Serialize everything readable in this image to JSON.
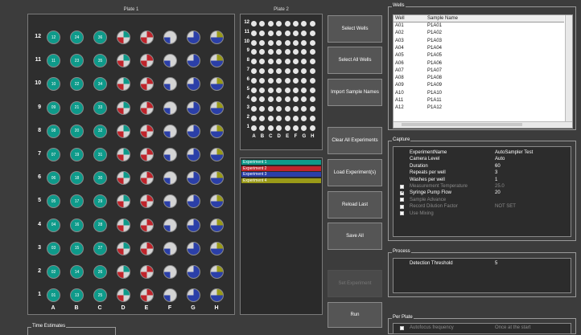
{
  "plate1": {
    "title": "Plate 1",
    "row_labels": [
      "12",
      "11",
      "10",
      "9",
      "8",
      "7",
      "6",
      "5",
      "4",
      "3",
      "2",
      "1"
    ],
    "col_labels": [
      "A",
      "B",
      "C",
      "D",
      "E",
      "F",
      "G",
      "H"
    ],
    "well_numbers": [
      [
        "12",
        "24",
        "36"
      ],
      [
        "11",
        "23",
        "35"
      ],
      [
        "10",
        "22",
        "34"
      ],
      [
        "09",
        "21",
        "33"
      ],
      [
        "08",
        "20",
        "32"
      ],
      [
        "07",
        "19",
        "31"
      ],
      [
        "06",
        "18",
        "30"
      ],
      [
        "05",
        "17",
        "29"
      ],
      [
        "04",
        "16",
        "28"
      ],
      [
        "03",
        "15",
        "27"
      ],
      [
        "02",
        "14",
        "26"
      ],
      [
        "01",
        "13",
        "25"
      ]
    ],
    "colors": {
      "teal": "#0e9a8a",
      "red": "#c0242b",
      "blue": "#2b3fa8",
      "olive": "#9a9a18",
      "grey": "#d4d4d4"
    }
  },
  "plate2": {
    "title": "Plate 2",
    "row_labels": [
      "12",
      "11",
      "10",
      "9",
      "8",
      "7",
      "6",
      "5",
      "4",
      "3",
      "2",
      "1"
    ],
    "col_labels": [
      "A",
      "B",
      "C",
      "D",
      "E",
      "F",
      "G",
      "H"
    ]
  },
  "buttons": {
    "select_wells": "Select Wells",
    "select_all_wells": "Select All Wells",
    "import_sample_names": "Import Sample Names",
    "clear_all_experiments": "Clear All Experiments",
    "load_experiments": "Load Experiment(s)",
    "reload_last": "Reload Last",
    "save_all": "Save All",
    "set_experiment": "Set Experiment",
    "run": "Run"
  },
  "experiments": [
    {
      "label": "Experiment 1",
      "color": "#0e9a8a"
    },
    {
      "label": "Experiment 2",
      "color": "#c0242b"
    },
    {
      "label": "Experiment 3",
      "color": "#2b3fa8"
    },
    {
      "label": "Experiment 4",
      "color": "#9a9a18"
    }
  ],
  "wells_panel": {
    "title": "Wells",
    "headers": [
      "Well",
      "Sample Name"
    ],
    "rows": [
      [
        "A01",
        "P1A01"
      ],
      [
        "A02",
        "P1A02"
      ],
      [
        "A03",
        "P1A03"
      ],
      [
        "A04",
        "P1A04"
      ],
      [
        "A05",
        "P1A05"
      ],
      [
        "A06",
        "P1A06"
      ],
      [
        "A07",
        "P1A07"
      ],
      [
        "A08",
        "P1A08"
      ],
      [
        "A09",
        "P1A09"
      ],
      [
        "A10",
        "P1A10"
      ],
      [
        "A11",
        "P1A11"
      ],
      [
        "A12",
        "P1A12"
      ]
    ]
  },
  "capture": {
    "title": "Capture",
    "rows": [
      {
        "label": "ExperimentName",
        "value": "AutoSampler Test",
        "check": false,
        "checked": false,
        "enabled": true
      },
      {
        "label": "Camera Level",
        "value": "Auto",
        "check": false,
        "checked": false,
        "enabled": true
      },
      {
        "label": "Duration",
        "value": "60",
        "check": false,
        "checked": false,
        "enabled": true
      },
      {
        "label": "Repeats per well",
        "value": "3",
        "check": false,
        "checked": false,
        "enabled": true
      },
      {
        "label": "Washes per well",
        "value": "1",
        "check": false,
        "checked": false,
        "enabled": true
      },
      {
        "label": "Measurement Temperature",
        "value": "25.0",
        "check": true,
        "checked": false,
        "enabled": false
      },
      {
        "label": "Syringe Pump Flow",
        "value": "20",
        "check": true,
        "checked": true,
        "enabled": true
      },
      {
        "label": "Sample Advance",
        "value": "",
        "check": true,
        "checked": false,
        "enabled": false
      },
      {
        "label": "Record Dilution Factor",
        "value": "NOT SET",
        "check": true,
        "checked": false,
        "enabled": false
      },
      {
        "label": "Use Mixing",
        "value": "",
        "check": true,
        "checked": false,
        "enabled": false
      }
    ]
  },
  "process": {
    "title": "Process",
    "label": "Detection Threshold",
    "value": "5"
  },
  "per_plate": {
    "title": "Per Plate",
    "label": "Autofocus frequency",
    "value": "Once at the start"
  },
  "time_estimates": {
    "title": "Time Estimates"
  }
}
